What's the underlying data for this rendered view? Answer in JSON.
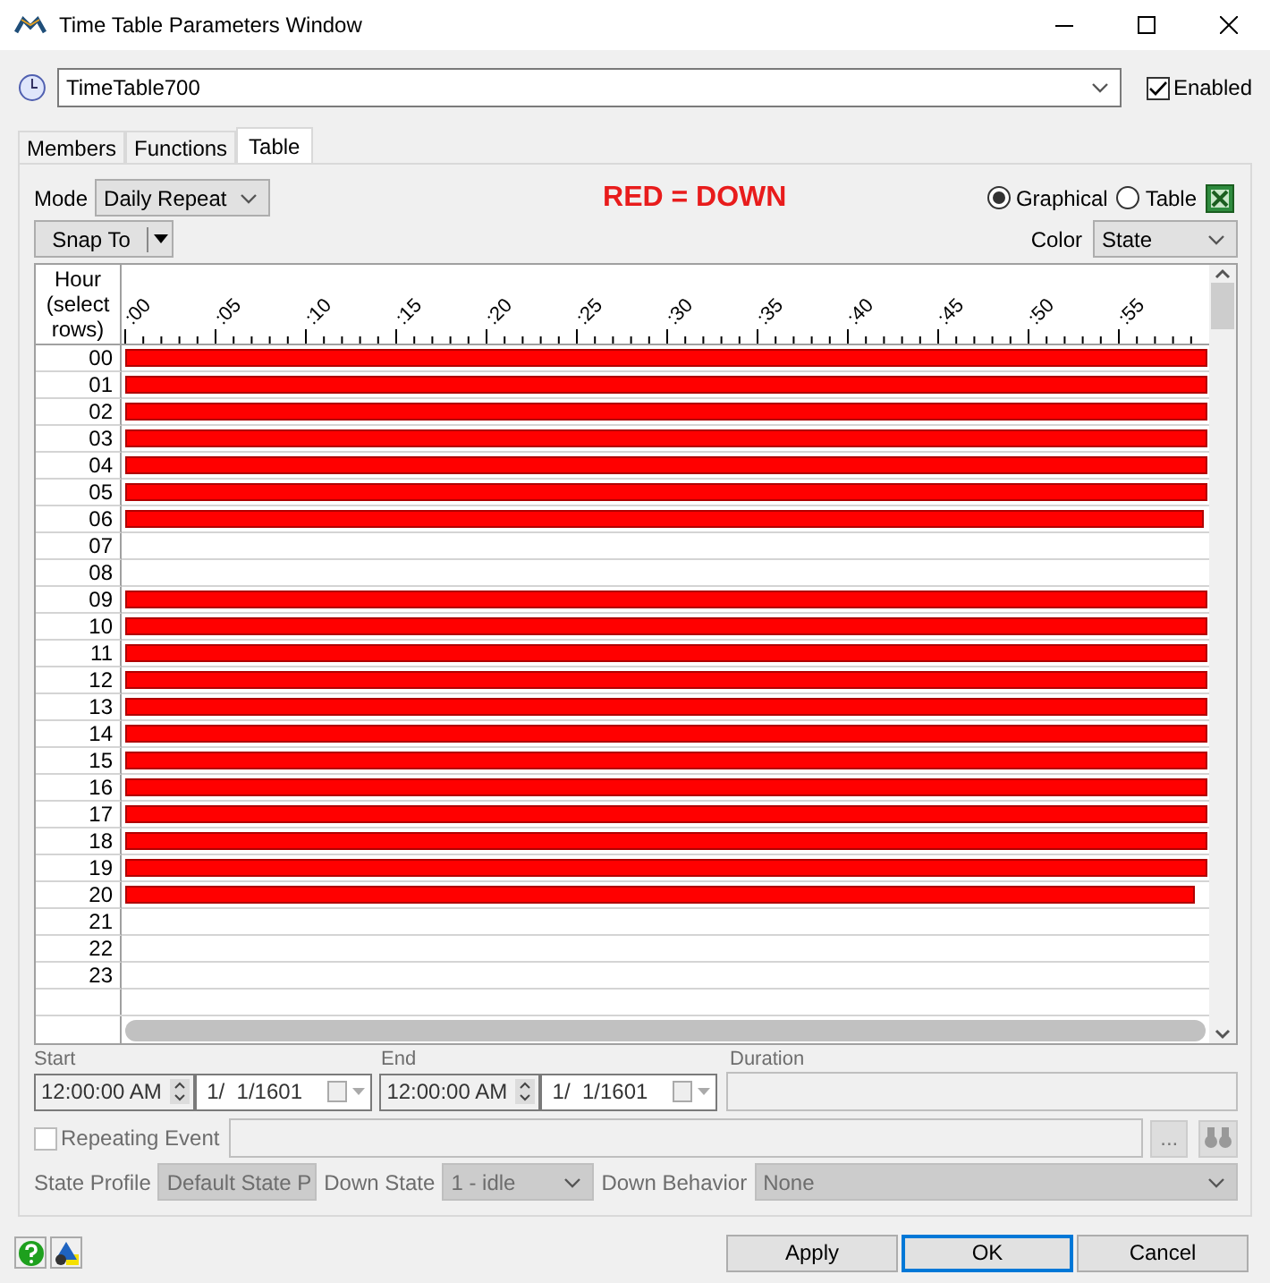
{
  "window": {
    "title": "Time Table Parameters Window"
  },
  "timetable": {
    "value": "TimeTable700",
    "enabled": {
      "label": "Enabled",
      "checked": true
    }
  },
  "tabs": [
    {
      "label": "Members",
      "selected": false
    },
    {
      "label": "Functions",
      "selected": false
    },
    {
      "label": "Table",
      "selected": true
    }
  ],
  "mode": {
    "label": "Mode",
    "value": "Daily Repeat"
  },
  "legend": "RED = DOWN",
  "view_options": [
    {
      "label": "Graphical",
      "selected": true
    },
    {
      "label": "Table",
      "selected": false
    }
  ],
  "snap_button": "Snap To",
  "color": {
    "label": "Color",
    "value": "State"
  },
  "schedule": {
    "hour_header": "Hour (select rows)",
    "minute_labels": [
      ":00",
      ":05",
      ":10",
      ":15",
      ":20",
      ":25",
      ":30",
      ":35",
      ":40",
      ":45",
      ":50",
      ":55"
    ],
    "rows": [
      {
        "hour": "00",
        "level": 1
      },
      {
        "hour": "01",
        "level": 1
      },
      {
        "hour": "02",
        "level": 1
      },
      {
        "hour": "03",
        "level": 1
      },
      {
        "hour": "04",
        "level": 1
      },
      {
        "hour": "05",
        "level": 1
      },
      {
        "hour": "06",
        "level": 0.997
      },
      {
        "hour": "07"
      },
      {
        "hour": "08"
      },
      {
        "hour": "09",
        "level": 1
      },
      {
        "hour": "10",
        "level": 1
      },
      {
        "hour": "11",
        "level": 1
      },
      {
        "hour": "12",
        "level": 1
      },
      {
        "hour": "13",
        "level": 1
      },
      {
        "hour": "14",
        "level": 1
      },
      {
        "hour": "15",
        "level": 1
      },
      {
        "hour": "16",
        "level": 1
      },
      {
        "hour": "17",
        "level": 1
      },
      {
        "hour": "18",
        "level": 1
      },
      {
        "hour": "19",
        "level": 1
      },
      {
        "hour": "20",
        "level": 0.988
      },
      {
        "hour": "21"
      },
      {
        "hour": "22"
      },
      {
        "hour": "23"
      }
    ]
  },
  "event": {
    "start_label": "Start",
    "start_time": "12:00:00 AM",
    "start_date": "1/  1/1601",
    "end_label": "End",
    "end_time": "12:00:00 AM",
    "end_date": "1/  1/1601",
    "duration_label": "Duration",
    "repeating": {
      "label": "Repeating Event",
      "checked": false
    },
    "browse_button": "...",
    "state_profile": {
      "label": "State Profile",
      "value": "Default State P"
    },
    "down_state": {
      "label": "Down State",
      "value": "1 - idle"
    },
    "down_behavior": {
      "label": "Down Behavior",
      "value": "None"
    }
  },
  "buttons": [
    {
      "label": "Apply",
      "selected": false
    },
    {
      "label": "OK",
      "selected": true
    },
    {
      "label": "Cancel",
      "selected": false
    }
  ]
}
